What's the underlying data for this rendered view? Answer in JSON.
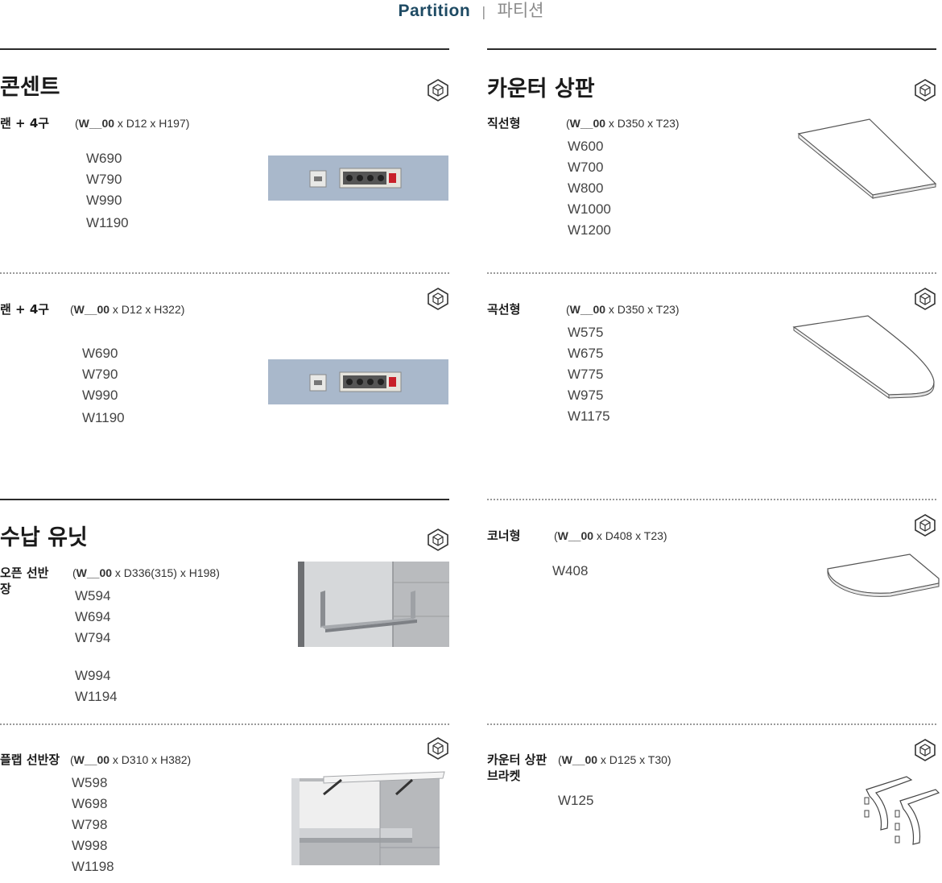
{
  "header": {
    "title_en": "Partition",
    "divider": "|",
    "title_ko": "파티션"
  },
  "consent": {
    "title": "콘센트",
    "item1": {
      "label": "랜 + 4구",
      "dim_open": "(",
      "dim_bold": "W__00",
      "dim_rest": " x D12 x H197)",
      "sizes": [
        "W690",
        "W790",
        "W990",
        "W1190"
      ]
    },
    "item2": {
      "label": "랜 + 4구",
      "dim_open": "(",
      "dim_bold": "W__00",
      "dim_rest": " x D12 x H322)",
      "sizes": [
        "W690",
        "W790",
        "W990",
        "W1190"
      ]
    }
  },
  "counter": {
    "title": "카운터 상판",
    "straight": {
      "label": "직선형",
      "dim_open": "(",
      "dim_bold": "W__00",
      "dim_rest": " x D350 x T23)",
      "sizes": [
        "W600",
        "W700",
        "W800",
        "W1000",
        "W1200"
      ]
    },
    "curved": {
      "label": "곡선형",
      "dim_open": "(",
      "dim_bold": "W__00",
      "dim_rest": " x D350 x T23)",
      "sizes": [
        "W575",
        "W675",
        "W775",
        "W975",
        "W1175"
      ]
    },
    "corner": {
      "label": "코너형",
      "dim_open": "(",
      "dim_bold": "W__00",
      "dim_rest": " x D408 x T23)",
      "sizes": [
        "W408"
      ]
    },
    "bracket": {
      "label_line1": "카운터 상판",
      "label_line2": "브라켓",
      "dim_open": "(",
      "dim_bold": "W__00",
      "dim_rest": " x D125 x T30)",
      "sizes": [
        "W125"
      ]
    }
  },
  "storage": {
    "title": "수납 유닛",
    "open_shelf": {
      "label_line1": "오픈 선반",
      "label_line2": "장",
      "dim_open": "(",
      "dim_bold": "W__00",
      "dim_rest": " x D336(315) x H198)",
      "sizes": [
        "W594",
        "W694",
        "W794"
      ],
      "sizes_more": [
        "W994",
        "W1194"
      ]
    },
    "flap": {
      "label": "플랩 선반장",
      "dim_open": "(",
      "dim_bold": "W__00",
      "dim_rest": " x D310 x H382)",
      "sizes": [
        "W598",
        "W698",
        "W798",
        "W998",
        "W1198"
      ]
    }
  },
  "icons": {
    "product": "cube-hexagon-icon"
  },
  "colors": {
    "accent": "#1e4a63",
    "panel_blue": "#a9b8cb",
    "rule": "#2b2b2b"
  }
}
